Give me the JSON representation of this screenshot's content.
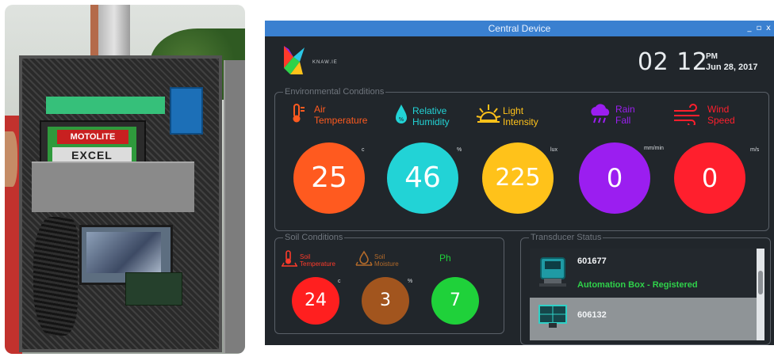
{
  "photo": {
    "battery_logo": "MOTOLITE",
    "battery_brand": "EXCEL"
  },
  "window": {
    "title": "Central Device",
    "controls": [
      "_",
      "▫",
      "x"
    ]
  },
  "logo": {
    "text": "KNAW.IE"
  },
  "clock": {
    "time": "02 12",
    "ampm": "PM",
    "date": "Jun 28, 2017"
  },
  "environment": {
    "legend": "Environmental Conditions",
    "params": [
      {
        "label_lines": [
          "Air",
          "Temperature"
        ],
        "icon": "thermometer-icon",
        "value": "25",
        "unit": "c",
        "color": "#ff5a1f",
        "label_color": "#ff5a1f"
      },
      {
        "label_lines": [
          "Relative",
          "Humidity"
        ],
        "icon": "water-drop-icon",
        "value": "46",
        "unit": "%",
        "color": "#22d3d6",
        "label_color": "#22d3d6"
      },
      {
        "label_lines": [
          "Light",
          "Intensity"
        ],
        "icon": "sun-icon",
        "value": "225",
        "unit": "lux",
        "color": "#ffc21a",
        "label_color": "#ffc21a"
      },
      {
        "label_lines": [
          "Rain",
          "Fall"
        ],
        "icon": "rain-cloud-icon",
        "value": "0",
        "unit": "mm/min",
        "color": "#9b1ef0",
        "label_color": "#9b1ef0"
      },
      {
        "label_lines": [
          "Wind",
          "Speed"
        ],
        "icon": "wind-icon",
        "value": "0",
        "unit": "m/s",
        "color": "#ff1f2d",
        "label_color": "#ff1f2d"
      }
    ]
  },
  "soil": {
    "legend": "Soil Conditions",
    "params": [
      {
        "label_lines": [
          "Soil",
          "Temperature"
        ],
        "icon": "soil-thermometer-icon",
        "value": "24",
        "unit": "c",
        "color": "#ff1f1f",
        "label_color": "#ff3b2b"
      },
      {
        "label_lines": [
          "Soil",
          "Moisture"
        ],
        "icon": "soil-moisture-icon",
        "value": "3",
        "unit": "%",
        "color": "#a2551e",
        "label_color": "#b36a2a"
      },
      {
        "label_lines": [
          "Ph"
        ],
        "icon": "",
        "value": "7",
        "unit": "",
        "color": "#1fd13a",
        "label_color": "#1fd13a"
      }
    ]
  },
  "transducer": {
    "legend": "Transducer Status",
    "items": [
      {
        "id": "601677",
        "status": "Automation Box - Registered"
      },
      {
        "id": "606132",
        "status": ""
      }
    ]
  }
}
